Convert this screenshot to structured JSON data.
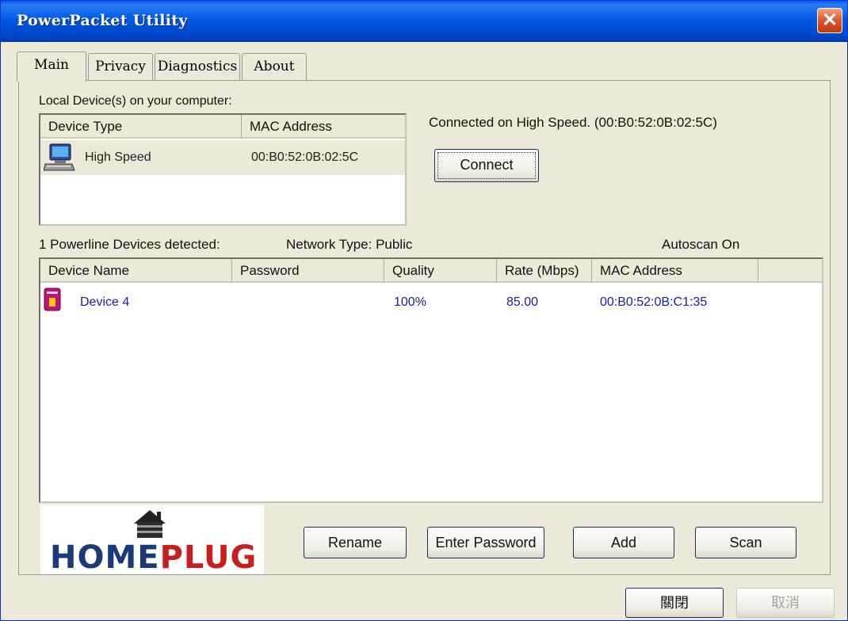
{
  "window": {
    "title": "PowerPacket Utility"
  },
  "tabs": [
    {
      "label": "Main"
    },
    {
      "label": "Privacy"
    },
    {
      "label": "Diagnostics"
    },
    {
      "label": "About"
    }
  ],
  "local": {
    "section_label": "Local Device(s) on your computer:",
    "columns": [
      "Device Type",
      "MAC Address"
    ],
    "rows": [
      {
        "device_type": "High Speed",
        "mac": "00:B0:52:0B:02:5C"
      }
    ],
    "status": "Connected on  High Speed. (00:B0:52:0B:02:5C)",
    "connect_label": "Connect"
  },
  "powerline": {
    "detected_label": "1 Powerline Devices detected:",
    "network_type": "Network Type: Public",
    "autoscan": "Autoscan On",
    "columns": [
      "Device Name",
      "Password",
      "Quality",
      "Rate (Mbps)",
      "MAC Address"
    ],
    "rows": [
      {
        "name": "Device 4",
        "password": "",
        "quality": "100%",
        "rate": "85.00",
        "mac": "00:B0:52:0B:C1:35"
      }
    ]
  },
  "logo": {
    "text_home": "HOME",
    "text_plug": "PLUG"
  },
  "buttons": {
    "rename": "Rename",
    "enter_password": "Enter Password",
    "add": "Add",
    "scan": "Scan",
    "close": "關閉",
    "cancel": "取消"
  },
  "colors": {
    "title_blue": "#0054e3",
    "row_text": "#1a1aa8",
    "logo_blue": "#1b3a7a",
    "logo_red": "#c81e1e"
  }
}
